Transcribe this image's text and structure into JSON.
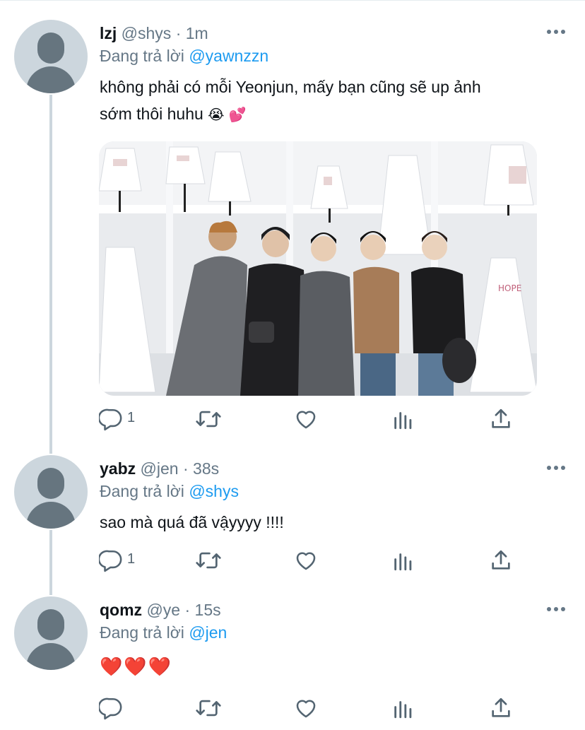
{
  "tweets": [
    {
      "name": "lzj",
      "handle": "@shys",
      "separator": "·",
      "time": "1m",
      "reply_prefix": "Đang trả lời",
      "reply_to": "@yawnzzn",
      "text_line1": "không phải có mỗi Yeonjun, mấy bạn cũng sẽ up ảnh",
      "text_line2": "sớm thôi huhu",
      "emoji": "😭 💕",
      "has_photo": true,
      "reply_count": "1"
    },
    {
      "name": "yabz",
      "handle": "@jen",
      "separator": "·",
      "time": "38s",
      "reply_prefix": "Đang trả lời",
      "reply_to": "@shys",
      "text_line1": "sao mà quá đã vậyyyy !!!!",
      "reply_count": "1"
    },
    {
      "name": "qomz",
      "handle": "@ye",
      "separator": "·",
      "time": "15s",
      "reply_prefix": "Đang trả lời",
      "reply_to": "@jen",
      "emoji": "❤️❤️❤️",
      "reply_count": ""
    }
  ],
  "icons": {
    "reply": "reply-icon",
    "retweet": "retweet-icon",
    "like": "heart-icon",
    "analytics": "analytics-icon",
    "share": "share-icon",
    "more": "more-icon"
  },
  "colors": {
    "accent": "#1d9bf0",
    "secondary_text": "#657786",
    "thread_line": "#ccd6dd"
  }
}
